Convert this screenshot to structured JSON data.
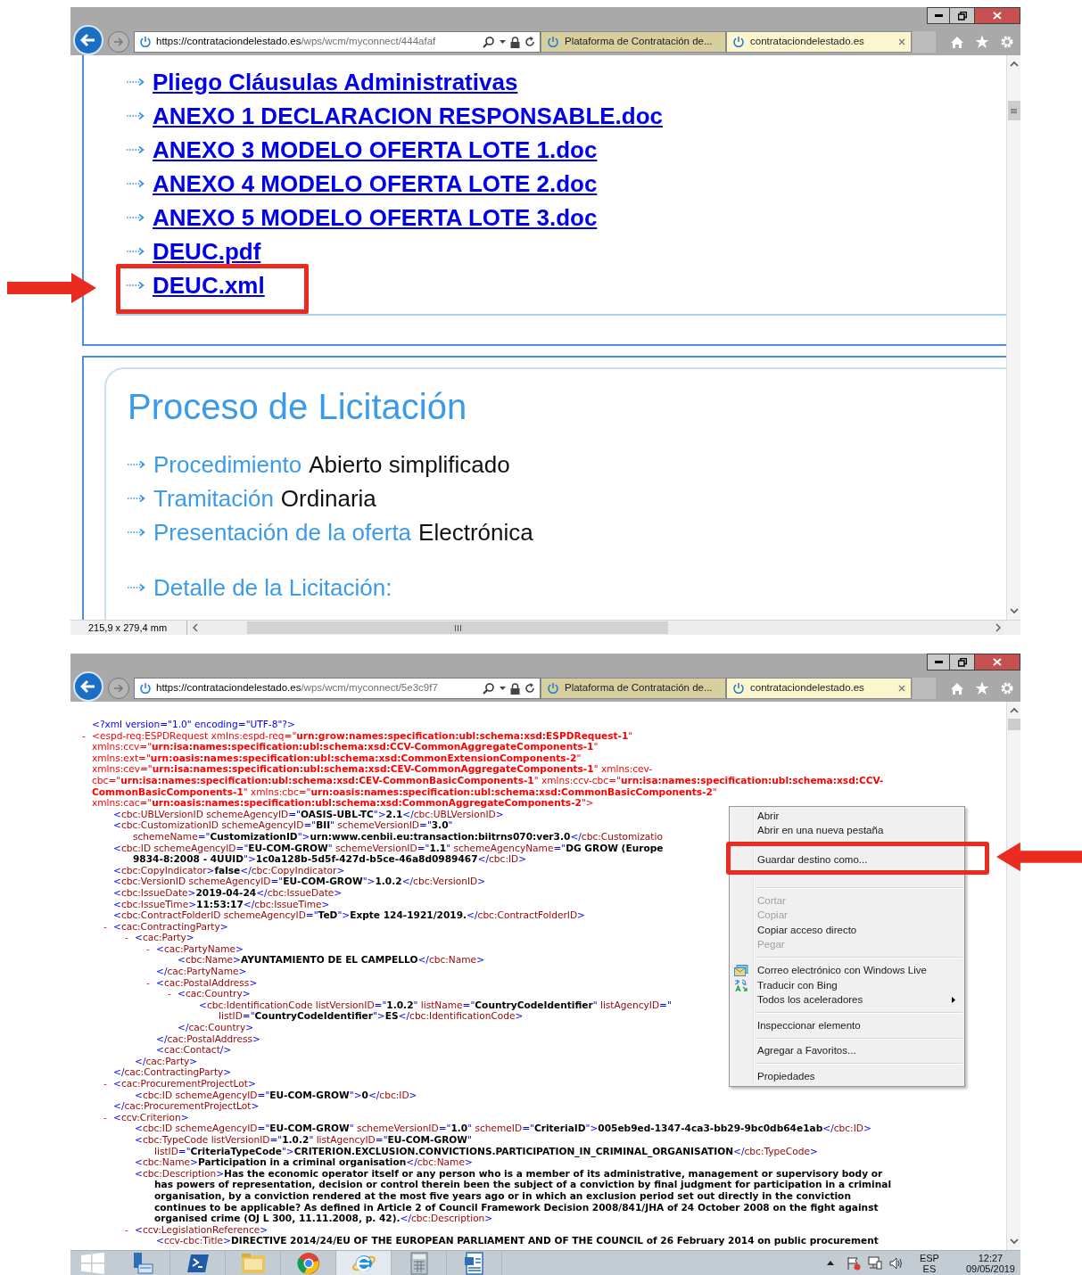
{
  "top_window": {
    "address": {
      "host": "https://contrataciondelestado.es",
      "path": "/wps/wcm/myconnect/444afaf"
    },
    "tabs": [
      {
        "title": "Plataforma de Contratación de...",
        "selected": false
      },
      {
        "title": "contrataciondelestado.es",
        "selected": true
      }
    ],
    "documents": [
      "Pliego Cláusulas Administrativas",
      "ANEXO 1 DECLARACION RESPONSABLE.doc",
      "ANEXO 3 MODELO OFERTA LOTE 1.doc",
      "ANEXO 4 MODELO OFERTA LOTE 2.doc",
      "ANEXO 5 MODELO OFERTA LOTE 3.doc",
      "DEUC.pdf",
      "DEUC.xml"
    ],
    "process": {
      "title": "Proceso de Licitación",
      "fields": [
        {
          "label": "Procedimiento",
          "value": "Abierto simplificado"
        },
        {
          "label": "Tramitación",
          "value": "Ordinaria"
        },
        {
          "label": "Presentación de la oferta",
          "value": "Electrónica"
        }
      ],
      "detail_label": "Detalle de la Licitación:"
    },
    "status_bar": {
      "page_size": "215,9 x 279,4 mm"
    }
  },
  "bottom_window": {
    "address": {
      "host": "https://contrataciondelestado.es",
      "path": "/wps/wcm/myconnect/5e3c9f7"
    },
    "tabs": [
      {
        "title": "Plataforma de Contratación de...",
        "selected": false
      },
      {
        "title": "contrataciondelestado.es",
        "selected": true
      }
    ],
    "xml_view": {
      "prolog": "<?xml version=\"1.0\" encoding=\"UTF-8\"?>",
      "root": {
        "kind": "root",
        "toggle": "-",
        "lines": [
          "<espd-req:ESPDRequest xmlns:espd-req=\"urn:grow:names:specification:ubl:schema:xsd:ESPDRequest-1\"",
          "xmlns:ccv=\"urn:isa:names:specification:ubl:schema:xsd:CCV-CommonAggregateComponents-1\"",
          "xmlns:ext=\"urn:oasis:names:specification:ubl:schema:xsd:CommonExtensionComponents-2\"",
          "xmlns:cev=\"urn:isa:names:specification:ubl:schema:xsd:CEV-CommonAggregateComponents-1\" xmlns:cev-",
          "cbc=\"urn:isa:names:specification:ubl:schema:xsd:CEV-CommonBasicComponents-1\" xmlns:ccv-cbc=\"urn:isa:names:specification:ubl:schema:xsd:CCV-",
          "CommonBasicComponents-1\" xmlns:cbc=\"urn:oasis:names:specification:ubl:schema:xsd:CommonBasicComponents-2\"",
          "xmlns:cac=\"urn:oasis:names:specification:ubl:schema:xsd:CommonAggregateComponents-2\">"
        ],
        "children": [
          {
            "kind": "element",
            "lines": [
              "<cbc:UBLVersionID schemeAgencyID=\"OASIS-UBL-TC\">2.1</cbc:UBLVersionID>"
            ]
          },
          {
            "kind": "element",
            "lines": [
              "<cbc:CustomizationID schemeAgencyID=\"BII\" schemeVersionID=\"3.0\"",
              "schemeName=\"CustomizationID\">urn:www.cenbii.eu:transaction:biitrns070:ver3.0</cbc:Customizatio"
            ]
          },
          {
            "kind": "element",
            "lines": [
              "<cbc:ID schemeAgencyID=\"EU-COM-GROW\" schemeVersionID=\"1.1\" schemeAgencyName=\"DG GROW (Europe",
              "9834-8:2008 - 4UUID\">1c0a128b-5d5f-427d-b5ce-46a8d0989467</cbc:ID>"
            ]
          },
          {
            "kind": "element",
            "lines": [
              "<cbc:CopyIndicator>false</cbc:CopyIndicator>"
            ]
          },
          {
            "kind": "element",
            "lines": [
              "<cbc:VersionID schemeAgencyID=\"EU-COM-GROW\">1.0.2</cbc:VersionID>"
            ]
          },
          {
            "kind": "element",
            "lines": [
              "<cbc:IssueDate>2019-04-24</cbc:IssueDate>"
            ]
          },
          {
            "kind": "element",
            "lines": [
              "<cbc:IssueTime>11:53:17</cbc:IssueTime>"
            ]
          },
          {
            "kind": "element",
            "lines": [
              "<cbc:ContractFolderID schemeAgencyID=\"TeD\">Expte 124-1921/2019.</cbc:ContractFolderID>"
            ]
          },
          {
            "kind": "element",
            "toggle": "-",
            "lines": [
              "<cac:ContractingParty>"
            ],
            "close": "</cac:ContractingParty>",
            "children": [
              {
                "kind": "element",
                "toggle": "-",
                "lines": [
                  "<cac:Party>"
                ],
                "close": "</cac:Party>",
                "children": [
                  {
                    "kind": "element",
                    "toggle": "-",
                    "lines": [
                      "<cac:PartyName>"
                    ],
                    "close": "</cac:PartyName>",
                    "children": [
                      {
                        "kind": "element",
                        "lines": [
                          "<cbc:Name>AYUNTAMIENTO DE EL CAMPELLO</cbc:Name>"
                        ]
                      }
                    ]
                  },
                  {
                    "kind": "element",
                    "toggle": "-",
                    "lines": [
                      "<cac:PostalAddress>"
                    ],
                    "close": "</cac:PostalAddress>",
                    "children": [
                      {
                        "kind": "element",
                        "toggle": "-",
                        "lines": [
                          "<cac:Country>"
                        ],
                        "close": "</cac:Country>",
                        "children": [
                          {
                            "kind": "element",
                            "lines": [
                              "<cbc:IdentificationCode listVersionID=\"1.0.2\" listName=\"CountryCodeIdentifier\" listAgencyID=\"",
                              "listID=\"CountryCodeIdentifier\">ES</cbc:IdentificationCode>"
                            ]
                          }
                        ]
                      }
                    ]
                  },
                  {
                    "kind": "element",
                    "lines": [
                      "<cac:Contact/>"
                    ]
                  }
                ]
              }
            ]
          },
          {
            "kind": "element",
            "toggle": "-",
            "lines": [
              "<cac:ProcurementProjectLot>"
            ],
            "close": "</cac:ProcurementProjectLot>",
            "children": [
              {
                "kind": "element",
                "lines": [
                  "<cbc:ID schemeAgencyID=\"EU-COM-GROW\">0</cbc:ID>"
                ]
              }
            ]
          },
          {
            "kind": "element",
            "toggle": "-",
            "lines": [
              "<ccv:Criterion>"
            ],
            "children": [
              {
                "kind": "element",
                "lines": [
                  "<cbc:ID schemeAgencyID=\"EU-COM-GROW\" schemeVersionID=\"1.0\" schemeID=\"CriteriaID\">005eb9ed-1347-4ca3-bb29-9bc0db64e1ab</cbc:ID>"
                ]
              },
              {
                "kind": "element",
                "lines": [
                  "<cbc:TypeCode listVersionID=\"1.0.2\" listAgencyID=\"EU-COM-GROW\"",
                  "listID=\"CriteriaTypeCode\">CRITERION.EXCLUSION.CONVICTIONS.PARTICIPATION_IN_CRIMINAL_ORGANISATION</cbc:TypeCode>"
                ]
              },
              {
                "kind": "element",
                "lines": [
                  "<cbc:Name>Participation in a criminal organisation</cbc:Name>"
                ]
              },
              {
                "kind": "element",
                "lines": [
                  "<cbc:Description>Has the economic operator itself or any person who is a member of its administrative, management or supervisory body or",
                  "has powers of representation, decision or control therein been the subject of a conviction by final judgment for participation in a criminal",
                  "organisation, by a conviction rendered at the most five years ago or in which an exclusion period set out directly in the conviction",
                  "continues to be applicable? As defined in Article 2 of Council Framework Decision 2008/841/JHA of 24 October 2008 on the fight against",
                  "organised crime (OJ L 300, 11.11.2008, p. 42).</cbc:Description>"
                ]
              },
              {
                "kind": "element",
                "toggle": "-",
                "lines": [
                  "<ccv:LegislationReference>"
                ],
                "children": [
                  {
                    "kind": "element",
                    "lines": [
                      "<ccv-cbc:Title>DIRECTIVE 2014/24/EU OF THE EUROPEAN PARLIAMENT AND OF THE COUNCIL of 26 February 2014 on public procurement"
                    ]
                  }
                ]
              }
            ]
          }
        ]
      }
    },
    "context_menu": {
      "items": [
        {
          "kind": "item",
          "label": "Abrir",
          "disabled": false
        },
        {
          "kind": "item",
          "label": "Abrir en una nueva pestaña",
          "disabled": false
        },
        {
          "kind": "obscured"
        },
        {
          "kind": "item",
          "label": "Guardar destino como...",
          "disabled": false
        },
        {
          "kind": "obscured"
        },
        {
          "kind": "separator"
        },
        {
          "kind": "item",
          "label": "Cortar",
          "disabled": true
        },
        {
          "kind": "item",
          "label": "Copiar",
          "disabled": true
        },
        {
          "kind": "item",
          "label": "Copiar acceso directo",
          "disabled": false
        },
        {
          "kind": "item",
          "label": "Pegar",
          "disabled": true
        },
        {
          "kind": "separator"
        },
        {
          "kind": "accelerator",
          "label": "Correo electrónico con Windows Live",
          "disabled": false
        },
        {
          "kind": "accelerator",
          "label": "Traducir con Bing",
          "disabled": false
        },
        {
          "kind": "submenu",
          "label": "Todos los aceleradores",
          "disabled": false
        },
        {
          "kind": "separator"
        },
        {
          "kind": "item",
          "label": "Inspeccionar elemento",
          "disabled": false
        },
        {
          "kind": "separator"
        },
        {
          "kind": "item",
          "label": "Agregar a Favoritos...",
          "disabled": false
        },
        {
          "kind": "separator"
        },
        {
          "kind": "item",
          "label": "Propiedades",
          "disabled": false
        }
      ]
    }
  },
  "taskbar": {
    "apps": [
      {
        "selected": false
      },
      {
        "selected": false
      },
      {
        "selected": false
      },
      {
        "selected": false
      },
      {
        "selected": true
      },
      {
        "selected": false
      },
      {
        "selected": false
      }
    ],
    "language": "ESP",
    "keyboard": "ES",
    "time": "12:27",
    "date": "09/05/2019"
  }
}
